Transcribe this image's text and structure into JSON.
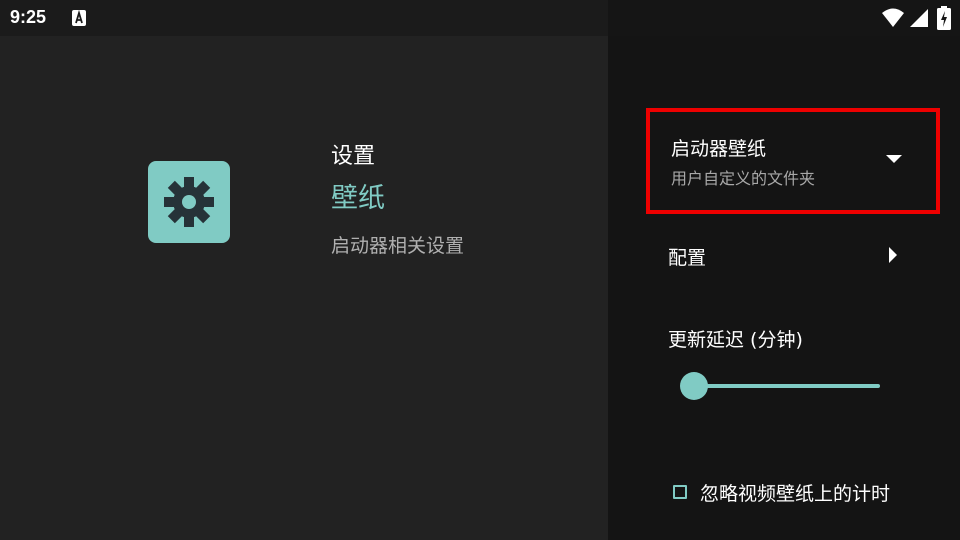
{
  "status_bar": {
    "time": "9:25",
    "icons": [
      "notification-a-icon",
      "wifi-icon",
      "signal-icon",
      "battery-charging-icon"
    ]
  },
  "left_panel": {
    "icon": "gear-icon",
    "breadcrumb": "设置",
    "title": "壁纸",
    "description": "启动器相关设置"
  },
  "right_panel": {
    "wallpaper_pref": {
      "title": "启动器壁纸",
      "summary": "用户自定义的文件夹",
      "icon": "dropdown-arrow-icon"
    },
    "config": {
      "label": "配置",
      "icon": "chevron-right-icon"
    },
    "update_delay": {
      "label": "更新延迟 (分钟)",
      "slider_value": 0
    },
    "ignore_timer": {
      "label": "忽略视频壁纸上的计时",
      "checked": false
    }
  },
  "colors": {
    "accent": "#80cbc4",
    "highlight_border": "#ee0000",
    "left_background": "#222222",
    "right_background": "#141414"
  }
}
